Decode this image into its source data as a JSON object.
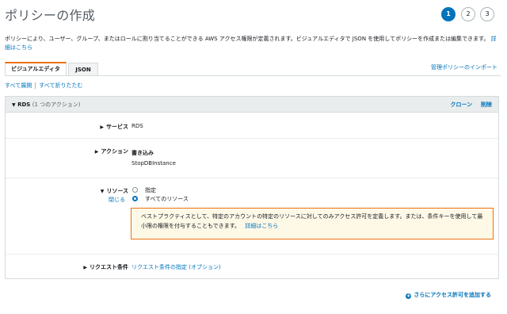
{
  "page": {
    "title": "ポリシーの作成"
  },
  "steps": [
    "1",
    "2",
    "3"
  ],
  "intro": {
    "text": "ポリシーにより、ユーザー、グループ、またはロールに割り当てることができる AWS アクセス権限が定義されます。ビジュアルエディタで JSON を使用してポリシーを作成または編集できます。",
    "link": "詳細はこちら"
  },
  "tabs": {
    "visual": "ビジュアルエディタ",
    "json": "JSON"
  },
  "import_link": "管理ポリシーのインポート",
  "expand_all": "すべて展開",
  "collapse_all": "すべて折りたたむ",
  "panel": {
    "service_name": "RDS",
    "action_count": "(1 つのアクション)",
    "clone": "クローン",
    "delete": "削除",
    "service_label": "サービス",
    "service_value": "RDS",
    "action_label": "アクション",
    "action_category": "書き込み",
    "action_name": "StopDBInstance",
    "resource_label": "リソース",
    "close_link": "閉じる",
    "resource_specific": "指定",
    "resource_all": "すべてのリソース",
    "warning_text": "ベストプラクティスとして、特定のアカウントの特定のリソースに対してのみアクセス許可を定義します。または、条件キーを使用して最小限の権限を付与することもできます。",
    "warning_link": "詳細はこちら",
    "request_label": "リクエスト条件",
    "request_link": "リクエスト条件の指定 (オプション)"
  },
  "add_permissions": "さらにアクセス許可を追加する",
  "colors": {
    "accent": "#0073bb",
    "tab_active": "#ec7211",
    "warning_bg": "#fef8e7"
  }
}
